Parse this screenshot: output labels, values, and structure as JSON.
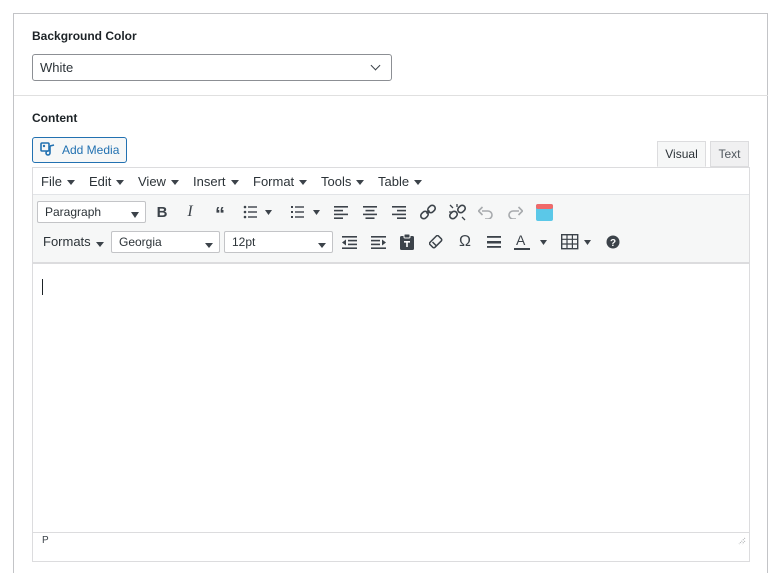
{
  "background_color": {
    "label": "Background Color",
    "value": "White"
  },
  "content": {
    "label": "Content",
    "add_media_label": "Add Media",
    "tabs": [
      "Visual",
      "Text"
    ],
    "active_tab": "Visual"
  },
  "menubar": [
    "File",
    "Edit",
    "View",
    "Insert",
    "Format",
    "Tools",
    "Table"
  ],
  "toolbar": {
    "block_format": "Paragraph",
    "formats_label": "Formats",
    "font_family": "Georgia",
    "font_size": "12pt",
    "row1_icons": [
      "bold-icon",
      "italic-icon",
      "blockquote-icon",
      "bullet-list-icon",
      "numbered-list-icon",
      "align-left-icon",
      "align-center-icon",
      "align-right-icon",
      "link-icon",
      "unlink-icon",
      "undo-icon",
      "redo-icon",
      "color-swatch-icon"
    ],
    "row2_icons": [
      "outdent-icon",
      "indent-icon",
      "paste-text-icon",
      "clear-formatting-icon",
      "special-character-icon",
      "horizontal-line-icon",
      "text-color-icon",
      "table-icon",
      "help-icon"
    ]
  },
  "statusbar": {
    "path": "P"
  }
}
